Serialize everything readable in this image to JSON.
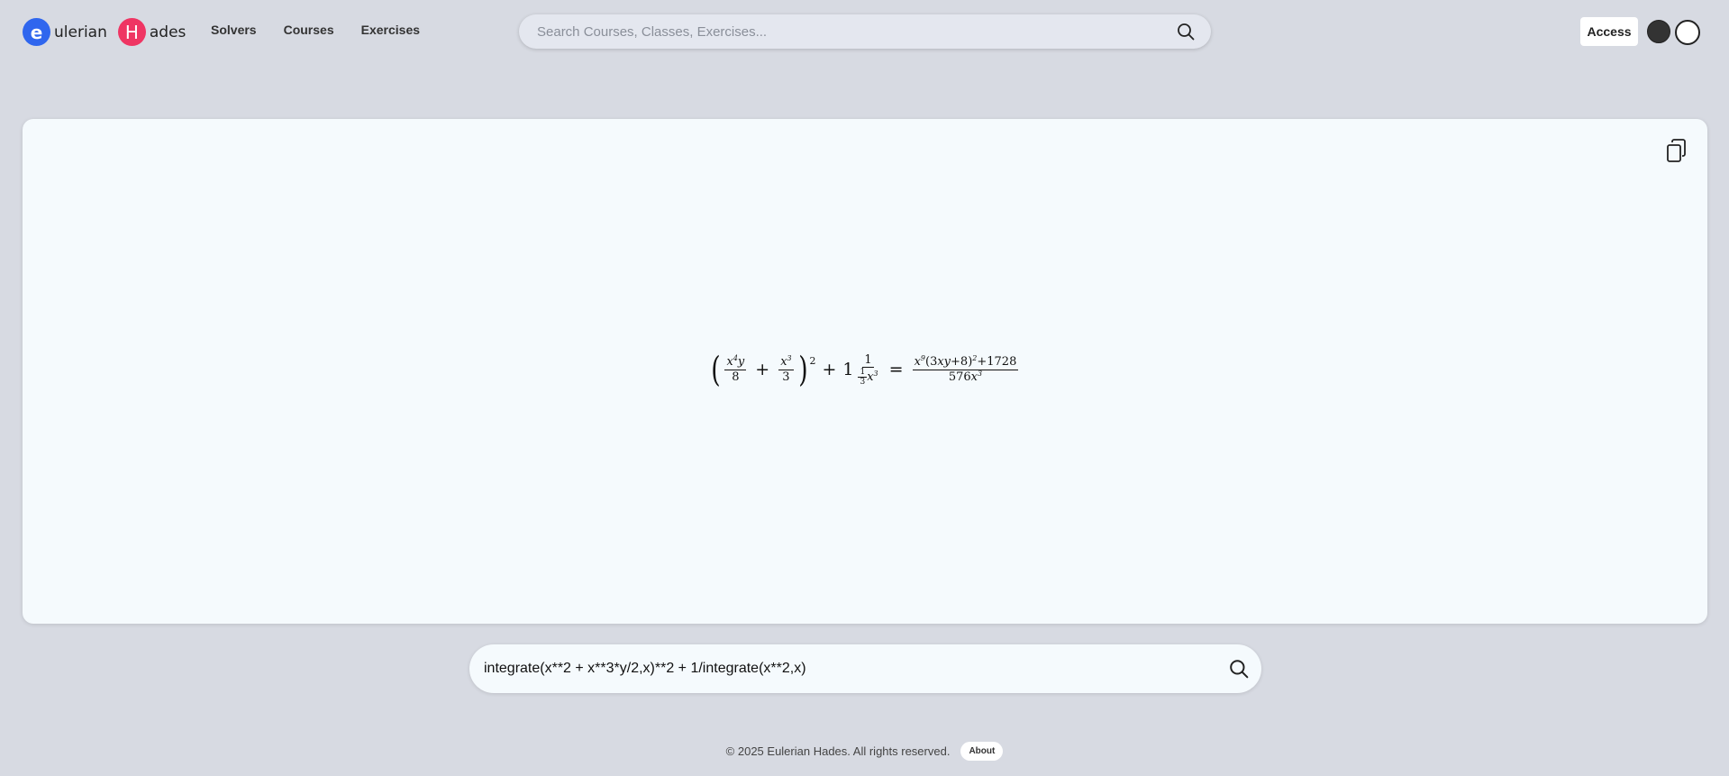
{
  "header": {
    "logo_left_letter": "e",
    "logo_left_word": "ulerian",
    "logo_right_letter": "H",
    "logo_right_word": "ades",
    "nav": [
      "Solvers",
      "Courses",
      "Exercises"
    ],
    "search_placeholder": "Search Courses, Classes, Exercises...",
    "access_label": "Access"
  },
  "colors": {
    "logo_e": "#2f66ee",
    "logo_h": "#ef3563",
    "background": "#d7dae2",
    "card": "#f5fafd"
  },
  "result": {
    "formula_latex": "\\left(\\frac{x^4 y}{8}+\\frac{x^3}{3}\\right)^2+1\\frac{1}{\\frac{1}{3}x^3}=\\frac{x^9(3xy+8)^2+1728}{576x^3}",
    "copy_icon": "copy-icon"
  },
  "input": {
    "expression": "integrate(x**2 + x**3*y/2,x)**2 + 1/integrate(x**2,x)"
  },
  "footer": {
    "copyright": "© 2025 Eulerian Hades. All rights reserved.",
    "about_label": "About"
  }
}
